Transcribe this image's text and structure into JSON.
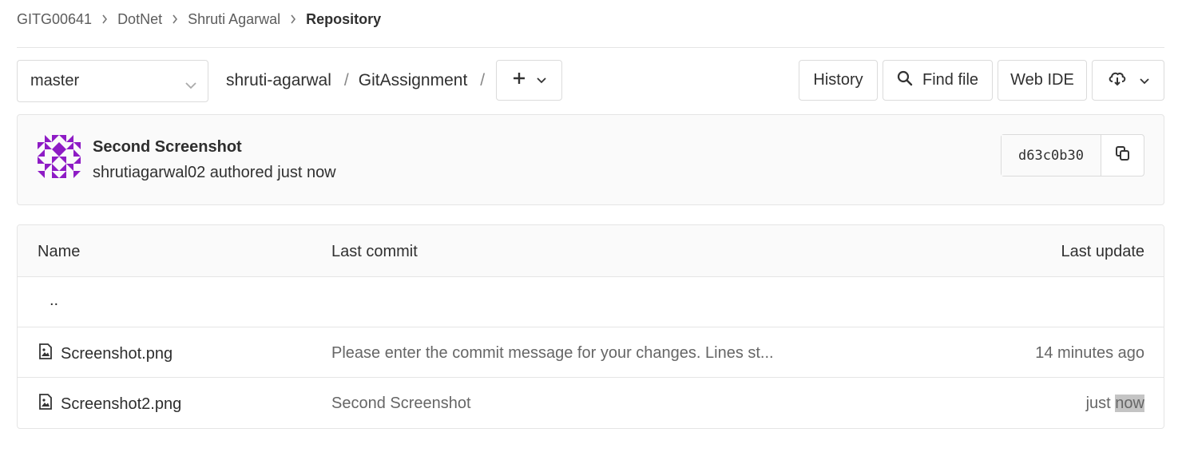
{
  "breadcrumb": {
    "items": [
      "GITG00641",
      "DotNet",
      "Shruti Agarwal"
    ],
    "current": "Repository"
  },
  "toolbar": {
    "branch": "master",
    "path_owner": "shruti-agarwal",
    "path_separator": "/",
    "path_repo": "GitAssignment",
    "history_label": "History",
    "find_file_label": "Find file",
    "web_ide_label": "Web IDE"
  },
  "commit": {
    "title": "Second Screenshot",
    "meta": "shrutiagarwal02 authored just now",
    "sha": "d63c0b30"
  },
  "table": {
    "headers": {
      "name": "Name",
      "last_commit": "Last commit",
      "last_update": "Last update"
    },
    "parent_dir": "..",
    "rows": [
      {
        "name": "Screenshot.png",
        "commit": "Please enter the commit message for your changes. Lines st...",
        "update": "14 minutes ago"
      },
      {
        "name": "Screenshot2.png",
        "commit": "Second Screenshot",
        "update_prefix": "just ",
        "update_highlight": "now"
      }
    ]
  },
  "colors": {
    "avatar": "#8e1bc5",
    "border": "#dbdbdb",
    "muted_text": "#666666"
  }
}
